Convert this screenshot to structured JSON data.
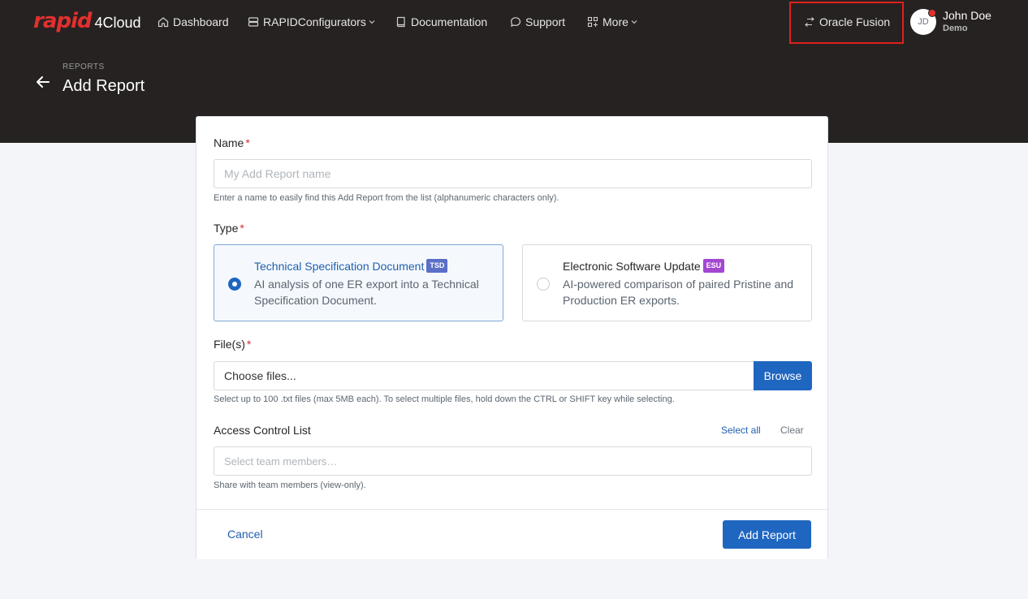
{
  "brand": {
    "logo_main": "rapid",
    "logo_sub": "4Cloud",
    "accent": "#e0302e"
  },
  "nav": {
    "dashboard": "Dashboard",
    "configurators": "RAPIDConfigurators",
    "documentation": "Documentation",
    "support": "Support",
    "more": "More"
  },
  "environment": {
    "label": "Oracle Fusion",
    "highlight_color": "#e0201d"
  },
  "user": {
    "initials": "JD",
    "name": "John Doe",
    "org": "Demo"
  },
  "header": {
    "breadcrumb": "REPORTS",
    "title": "Add Report"
  },
  "form": {
    "name": {
      "label": "Name",
      "required_mark": "*",
      "placeholder": "My Add Report name",
      "value": "",
      "help": "Enter a name to easily find this Add Report from the list (alphanumeric characters only)."
    },
    "type": {
      "label": "Type",
      "required_mark": "*",
      "options": [
        {
          "title": "Technical Specification Document",
          "badge": "TSD",
          "badge_color": "#5b6fc7",
          "description": "AI analysis of one ER export into a Technical Specification Document.",
          "selected": true
        },
        {
          "title": "Electronic Software Update",
          "badge": "ESU",
          "badge_color": "#a347d1",
          "description": "AI-powered comparison of paired Pristine and Production ER exports.",
          "selected": false
        }
      ]
    },
    "files": {
      "label": "File(s)",
      "required_mark": "*",
      "value": "Choose files...",
      "browse_label": "Browse",
      "help": "Select up to 100 .txt files (max 5MB each). To select multiple files, hold down the CTRL or SHIFT key while selecting."
    },
    "acl": {
      "label": "Access Control List",
      "select_all": "Select all",
      "clear": "Clear",
      "placeholder": "Select team members…",
      "help": "Share with team members (view-only)."
    },
    "actions": {
      "cancel": "Cancel",
      "submit": "Add Report"
    }
  },
  "colors": {
    "primary": "#1f66c0",
    "header_bg": "#262221",
    "required": "#d32f2f"
  }
}
